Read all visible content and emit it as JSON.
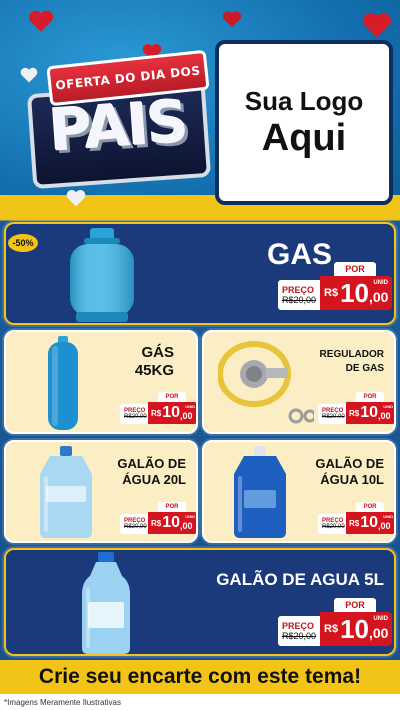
{
  "header": {
    "ribbon": "OFERTA DO DIA DOS",
    "headline": "PAIS",
    "logo_line1": "Sua Logo",
    "logo_line2": "Aqui"
  },
  "discount_badge": "-50%",
  "products": [
    {
      "name": "GAS",
      "price_label": "PREÇO",
      "old_price": "R$20,00",
      "por": "POR",
      "currency": "R$",
      "price_int": "10",
      "price_dec": ",00",
      "unit": "UNID",
      "icon": "gas-cylinder-icon"
    },
    {
      "name_line1": "GÁS",
      "name_line2": "45KG",
      "price_label": "PREÇO",
      "old_price": "R$20,00",
      "por": "POR",
      "currency": "R$",
      "price_int": "10",
      "price_dec": ",00",
      "unit": "UNID",
      "icon": "tall-gas-cylinder-icon"
    },
    {
      "name_line1": "REGULADOR",
      "name_line2": "DE GAS",
      "price_label": "PREÇO",
      "old_price": "R$20,00",
      "por": "POR",
      "currency": "R$",
      "price_int": "10",
      "price_dec": ",00",
      "unit": "UNID",
      "icon": "gas-regulator-icon"
    },
    {
      "name_line1": "GALÃO DE",
      "name_line2": "ÁGUA 20L",
      "price_label": "PREÇO",
      "old_price": "R$20,00",
      "por": "POR",
      "currency": "R$",
      "price_int": "10",
      "price_dec": ",00",
      "unit": "UNID",
      "icon": "water-jug-20l-icon"
    },
    {
      "name_line1": "GALÃO DE",
      "name_line2": "ÁGUA 10L",
      "price_label": "PREÇO",
      "old_price": "R$20,00",
      "por": "POR",
      "currency": "R$",
      "price_int": "10",
      "price_dec": ",00",
      "unit": "UNID",
      "icon": "water-jug-10l-icon"
    },
    {
      "name": "GALÃO DE AGUA 5L",
      "price_label": "PREÇO",
      "old_price": "R$20,00",
      "por": "POR",
      "currency": "R$",
      "price_int": "10",
      "price_dec": ",00",
      "unit": "UNID",
      "icon": "water-bottle-5l-icon"
    }
  ],
  "footer": {
    "cta": "Crie seu encarte com este tema!",
    "disclaimer": "*Imagens Meramente Ilustrativas"
  },
  "colors": {
    "dark_card": "#1b3a7c",
    "light_card": "#fbeec5",
    "accent_yellow": "#f3c418",
    "price_red": "#d4141e"
  }
}
